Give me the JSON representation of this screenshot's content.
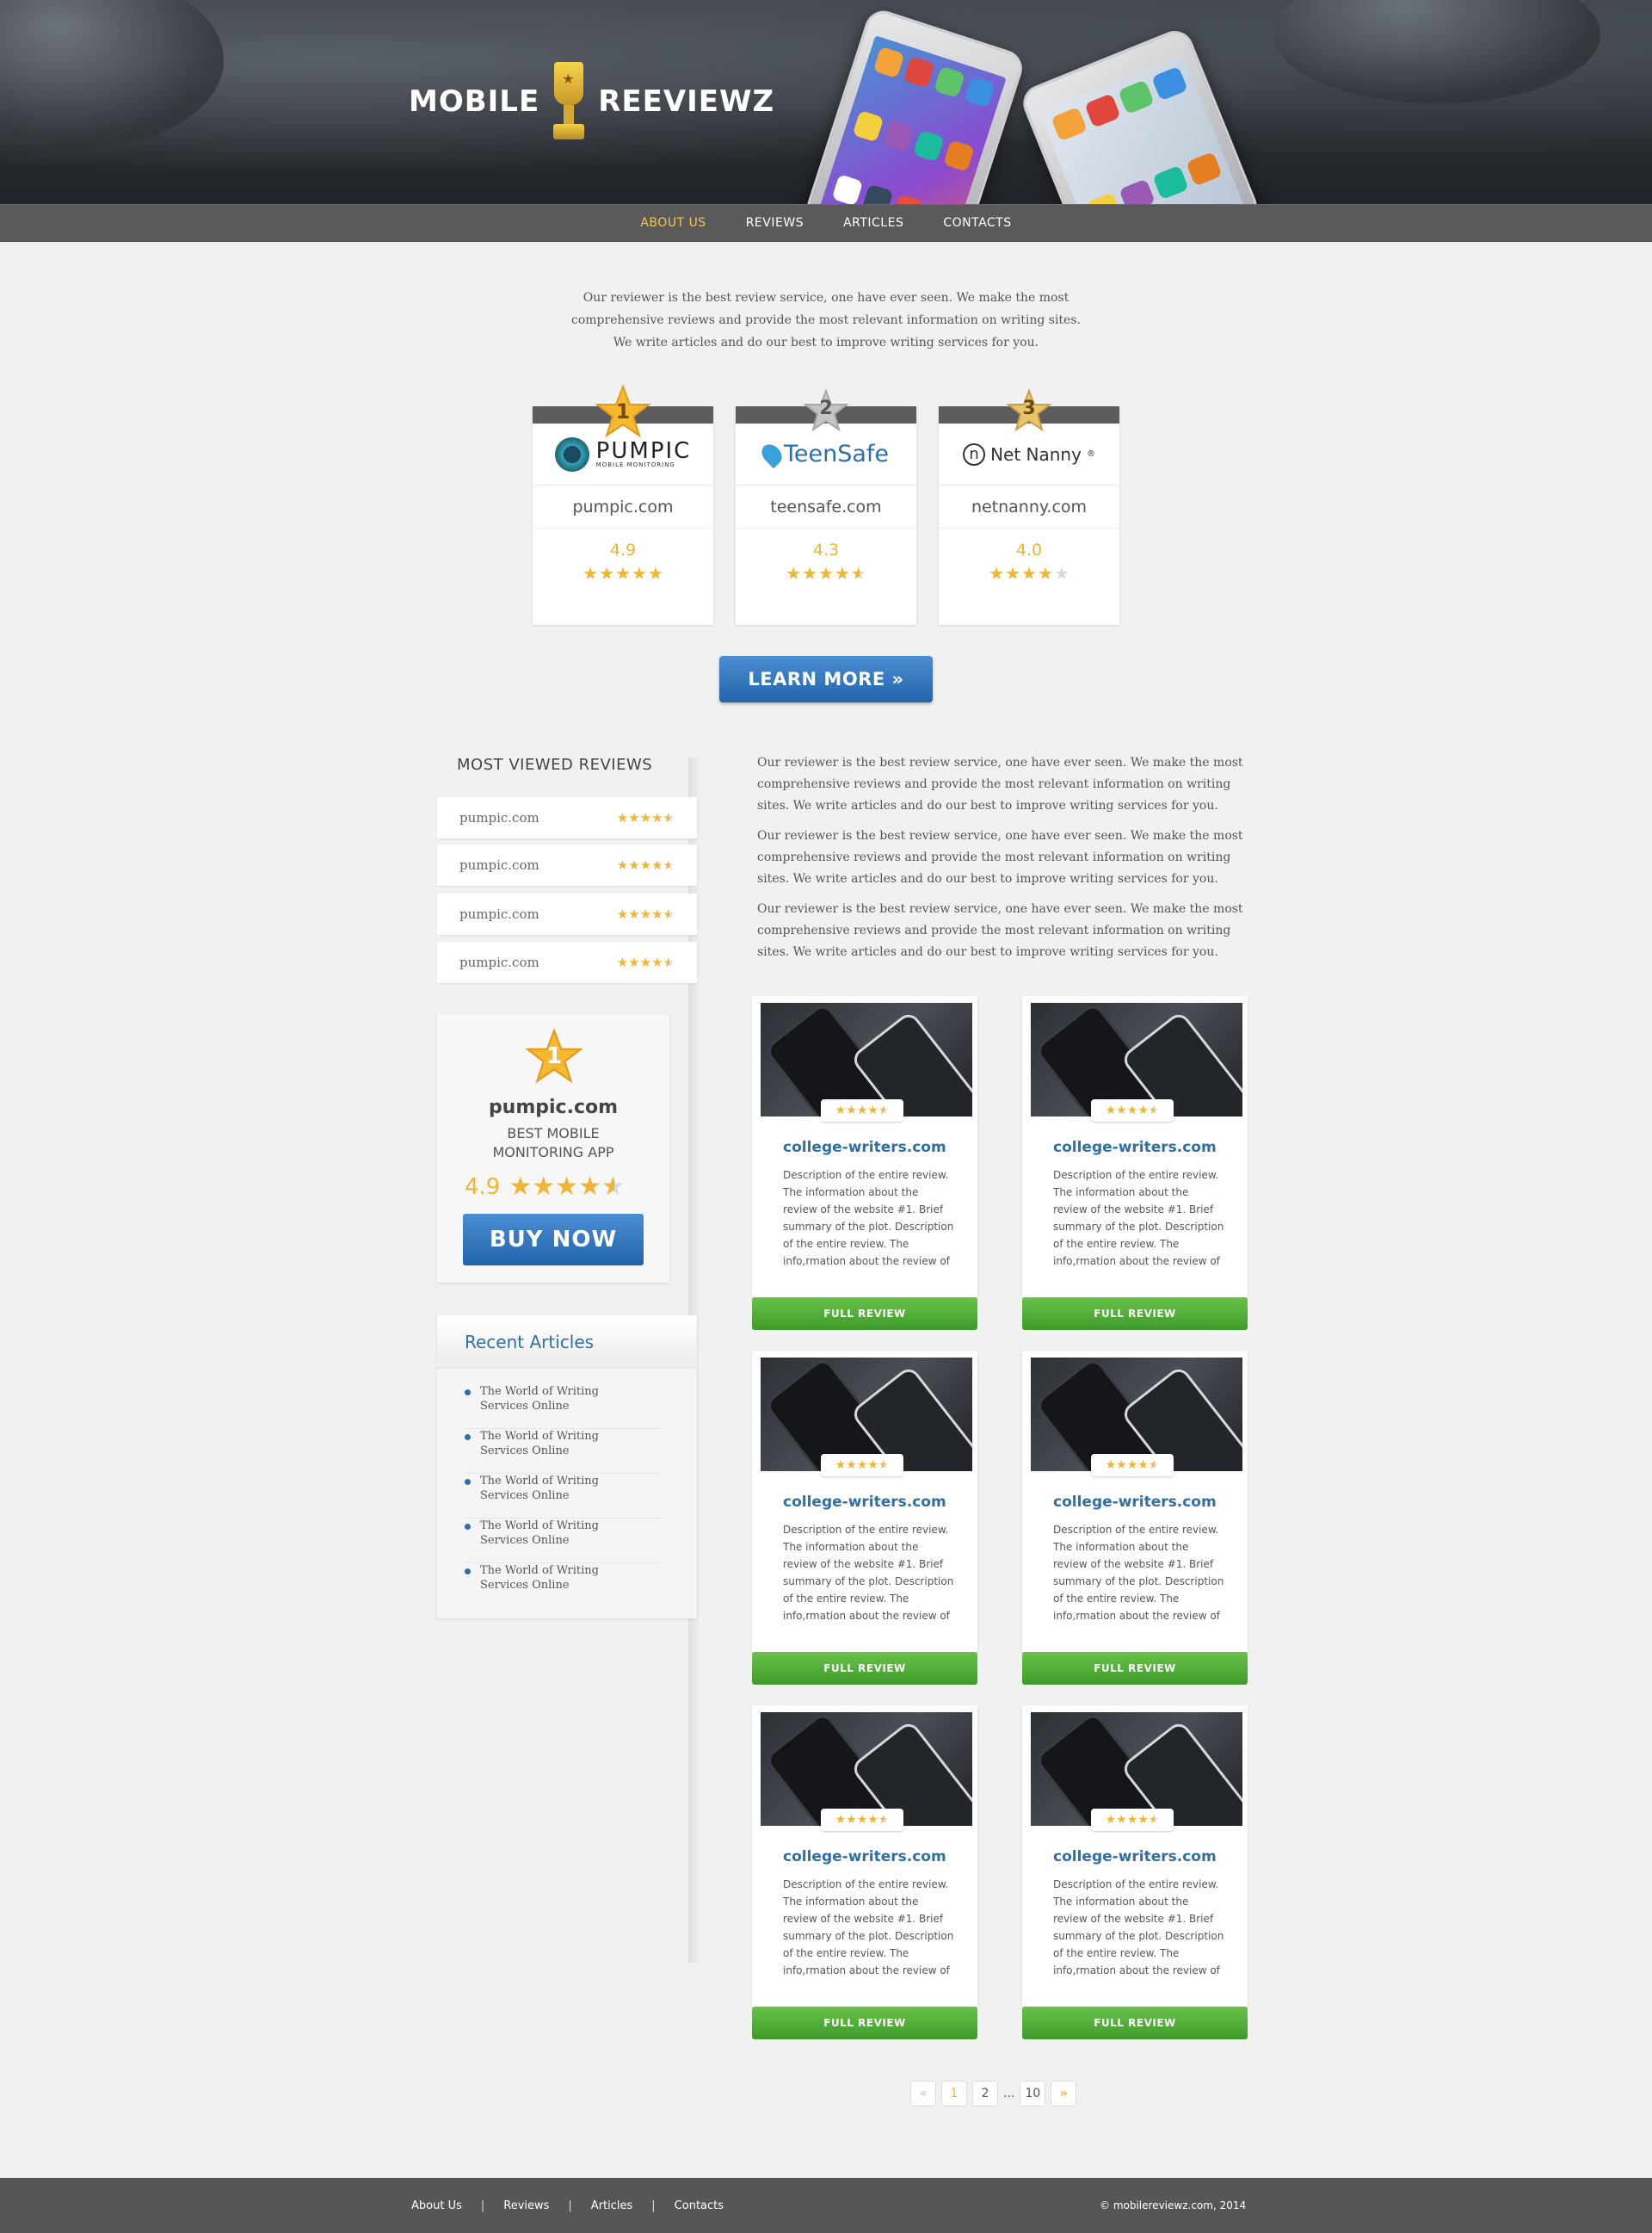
{
  "brand": {
    "word1": "MOBILE",
    "word2": "REEVIEWZ"
  },
  "nav": [
    "ABOUT US",
    "REVIEWS",
    "ARTICLES",
    "CONTACTS"
  ],
  "intro": "Our reviewer is the best review service, one have ever seen. We make the most comprehensive reviews and provide the most relevant information on writing sites. We write articles and do our best to improve writing services for you.",
  "top3": [
    {
      "rank": "1",
      "logo": "PUMPIC",
      "logo_sub": "MOBILE MONITORING",
      "domain": "pumpic.com",
      "score": "4.9",
      "stars": 5
    },
    {
      "rank": "2",
      "logo": "TeenSafe",
      "domain": "teensafe.com",
      "score": "4.3",
      "stars": 4.5
    },
    {
      "rank": "3",
      "logo": "Net Nanny",
      "logo_mark": "®",
      "domain": "netnanny.com",
      "score": "4.0",
      "stars": 4
    }
  ],
  "learn_more": "LEARN MORE",
  "learn_more_icon": "double-chevron-right-icon",
  "most_viewed": {
    "title": "MOST VIEWED REVIEWS",
    "items": [
      "pumpic.com",
      "pumpic.com",
      "pumpic.com",
      "pumpic.com"
    ]
  },
  "promo": {
    "rank": "1",
    "name": "pumpic.com",
    "sub1": "BEST MOBILE",
    "sub2": "MONITORING APP",
    "score": "4.9",
    "buy": "BUY NOW"
  },
  "recent": {
    "title": "Recent Articles",
    "items": [
      [
        "The World of Writing",
        "Services Online"
      ],
      [
        "The World of Writing",
        "Services Online"
      ],
      [
        "The World of Writing",
        "Services Online"
      ],
      [
        "The World of Writing",
        "Services Online"
      ],
      [
        "The World of Writing",
        "Services Online"
      ]
    ]
  },
  "main_text": [
    "Our reviewer is the best review service, one have ever seen. We make the most comprehensive reviews and provide the most relevant information on writing sites. We write articles and do our best to improve writing services for you.",
    "Our reviewer is the best review service, one have ever seen. We make the most comprehensive reviews and provide the most relevant information on writing sites. We write articles and do our best to improve writing services for you.",
    "Our reviewer is the best review service, one have ever seen. We make the most comprehensive reviews and provide the most relevant information on writing sites. We write articles and do our best to improve writing services for you."
  ],
  "reviews": [
    {
      "title": "college-writers.com",
      "desc": "Description of the entire review. The information about the review of the website #1. Brief summary of the plot. Description of the entire review. The info,rmation about the review of",
      "button": "FULL REVIEW"
    },
    {
      "title": "college-writers.com",
      "desc": "Description of the entire review. The information about the review of the website #1. Brief summary of the plot. Description of the entire review. The info,rmation about the review of",
      "button": "FULL REVIEW"
    },
    {
      "title": "college-writers.com",
      "desc": "Description of the entire review. The information about the review of the website #1. Brief summary of the plot. Description of the entire review. The info,rmation about the review of",
      "button": "FULL REVIEW"
    },
    {
      "title": "college-writers.com",
      "desc": "Description of the entire review. The information about the review of the website #1. Brief summary of the plot. Description of the entire review. The info,rmation about the review of",
      "button": "FULL REVIEW"
    },
    {
      "title": "college-writers.com",
      "desc": "Description of the entire review. The information about the review of the website #1. Brief summary of the plot. Description of the entire review. The info,rmation about the review of",
      "button": "FULL REVIEW"
    },
    {
      "title": "college-writers.com",
      "desc": "Description of the entire review. The information about the review of the website #1. Brief summary of the plot. Description of the entire review. The info,rmation about the review of",
      "button": "FULL REVIEW"
    }
  ],
  "pagination": {
    "prev": "«",
    "pages": [
      "1",
      "2"
    ],
    "ellipsis": "...",
    "last": "10",
    "next": "»",
    "current": "1"
  },
  "footer": {
    "links": [
      "About Us",
      "Reviews",
      "Articles",
      "Contacts"
    ],
    "separator": "|",
    "copyright": "© mobilereviewz.com, 2014"
  },
  "colors": {
    "accent_gold": "#f1b434",
    "link_blue": "#2e6fa8",
    "button_green": "#3e9a2a",
    "nav_bg": "#5a5a5a",
    "footer_bg": "#565656"
  }
}
